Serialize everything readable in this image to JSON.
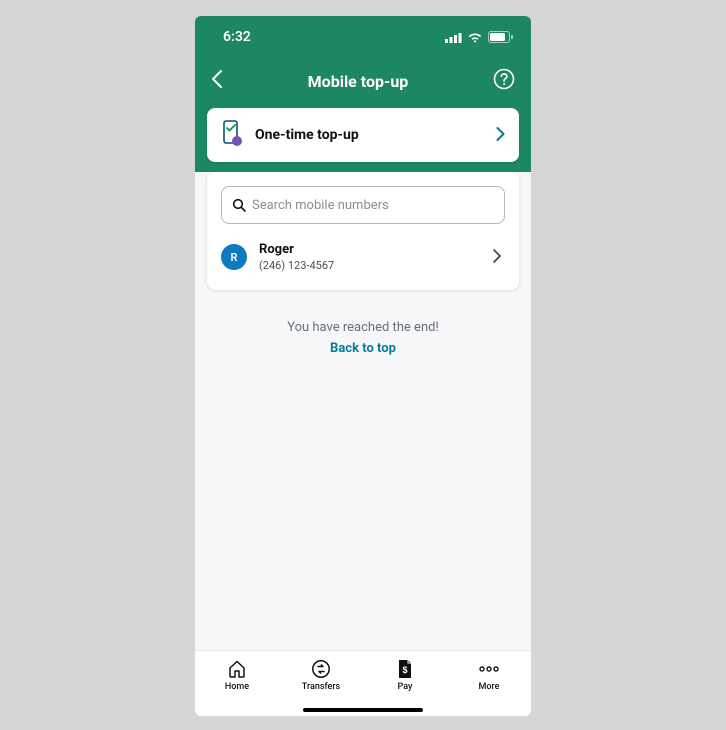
{
  "status": {
    "time": "6:32"
  },
  "header": {
    "title": "Mobile top-up"
  },
  "onetime": {
    "label": "One-time top-up"
  },
  "search": {
    "placeholder": "Search mobile numbers"
  },
  "contacts": [
    {
      "initial": "R",
      "name": "Roger",
      "number": "(246) 123-4567"
    }
  ],
  "footer": {
    "end_text": "You have reached the end!",
    "back_top": "Back to top"
  },
  "tabs": {
    "home": "Home",
    "transfers": "Transfers",
    "pay": "Pay",
    "more": "More"
  }
}
